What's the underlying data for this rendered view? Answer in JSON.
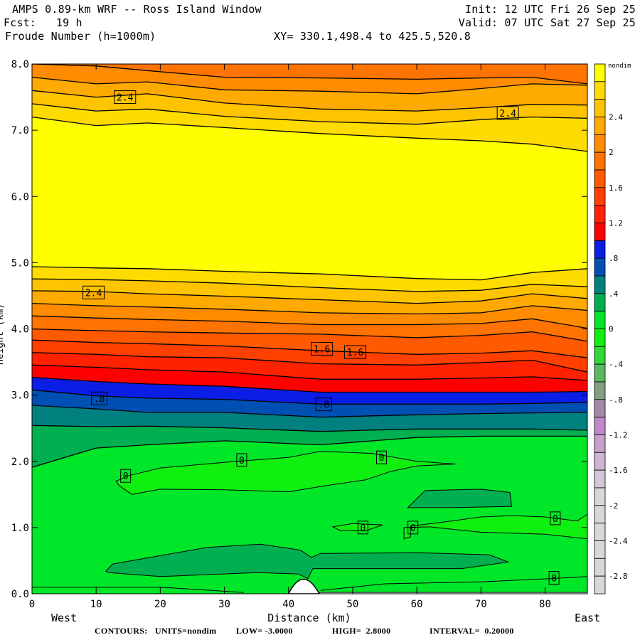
{
  "header": {
    "title": "AMPS 0.89-km WRF -- Ross Island Window",
    "init": "Init: 12 UTC Fri 26 Sep 25",
    "forecast": "Fcst:   19 h",
    "valid": "Valid: 07 UTC Sat 27 Sep 25",
    "field": "Froude Number (h=1000m)",
    "xy": "XY= 330.1,498.4 to 425.5,520.8"
  },
  "footer": {
    "contours": "CONTOURS:",
    "units": "UNITS=nondim",
    "low": "LOW= -3.0000",
    "high": "HIGH=  2.8000",
    "interval": "INTERVAL=  0.20000"
  },
  "chart_data": {
    "type": "heatmap",
    "subtype": "filled-contour cross-section",
    "title": "Froude Number (h=1000m)",
    "xlabel": "Distance (km)",
    "ylabel": "Height (km)",
    "x_left_label": "West",
    "x_right_label": "East",
    "xlim": [
      0,
      86.6
    ],
    "ylim": [
      0,
      8
    ],
    "x_ticks": [
      "0",
      "10",
      "20",
      "30",
      "40",
      "50",
      "60",
      "70",
      "80"
    ],
    "x_tick_values": [
      0,
      10,
      20,
      30,
      40,
      50,
      60,
      70,
      80
    ],
    "y_ticks": [
      "0.0",
      "1.0",
      "2.0",
      "3.0",
      "4.0",
      "5.0",
      "6.0",
      "7.0",
      "8.0"
    ],
    "y_tick_values": [
      0,
      1,
      2,
      3,
      4,
      5,
      6,
      7,
      8
    ],
    "units": "nondim",
    "contour_low": -3.0,
    "contour_high": 2.8,
    "contour_interval": 0.2,
    "colorbar": {
      "unit_label": "nondim",
      "levels_top_to_bottom": [
        3.0,
        2.8,
        2.6,
        2.4,
        2.2,
        2.0,
        1.8,
        1.6,
        1.4,
        1.2,
        1.0,
        0.8,
        0.6,
        0.4,
        0.2,
        0.0,
        -0.2,
        -0.4,
        -0.6,
        -0.8,
        -1.0,
        -1.2,
        -1.4,
        -1.6,
        -1.8,
        -2.0,
        -2.2,
        -2.4,
        -2.6,
        -2.8,
        -3.0
      ],
      "colors_top_to_bottom": [
        "#ffff00",
        "#ffdc00",
        "#ffc400",
        "#ffaa00",
        "#ff8c00",
        "#ff7300",
        "#ff5a00",
        "#ff4000",
        "#ff2200",
        "#ff0000",
        "#0a1ee6",
        "#0050b4",
        "#00807f",
        "#00b050",
        "#00e628",
        "#10f010",
        "#30d838",
        "#5ab860",
        "#80a080",
        "#a888a8",
        "#c088c8",
        "#c8a0cc",
        "#d0b4d4",
        "#d4c8d8",
        "#d8d8d8",
        "#d8d8d8",
        "#d8d8d8",
        "#d8d8d8",
        "#d8d8d8",
        "#d8d8d8"
      ],
      "labels": [
        {
          "text": "2.4",
          "value": 2.4
        },
        {
          "text": "2",
          "value": 2.0
        },
        {
          "text": "1.6",
          "value": 1.6
        },
        {
          "text": "1.2",
          "value": 1.2
        },
        {
          "text": ".8",
          "value": 0.8
        },
        {
          "text": ".4",
          "value": 0.4
        },
        {
          "text": "0",
          "value": 0.0
        },
        {
          "text": "-.4",
          "value": -0.4
        },
        {
          "text": "-.8",
          "value": -0.8
        },
        {
          "text": "-1.2",
          "value": -1.2
        },
        {
          "text": "-1.6",
          "value": -1.6
        },
        {
          "text": "-2",
          "value": -2.0
        },
        {
          "text": "-2.4",
          "value": -2.4
        },
        {
          "text": "-2.8",
          "value": -2.8
        }
      ]
    },
    "top_fill": "#ff7300",
    "x_samples_km": [
      0,
      10,
      18,
      30,
      45,
      60,
      70,
      78,
      86.6
    ],
    "contour_lines": [
      {
        "level": 2.0,
        "fill_below": "#ff8c00",
        "heights": [
          8.0,
          7.97,
          7.9,
          7.8,
          7.79,
          7.77,
          7.79,
          7.8,
          7.7
        ]
      },
      {
        "level": 2.2,
        "fill_below": "#ffaa00",
        "heights": [
          7.8,
          7.7,
          7.73,
          7.61,
          7.59,
          7.55,
          7.63,
          7.7,
          7.68
        ]
      },
      {
        "level": 2.4,
        "fill_below": "#ffc400",
        "heights": [
          7.6,
          7.5,
          7.55,
          7.41,
          7.32,
          7.29,
          7.34,
          7.39,
          7.38
        ]
      },
      {
        "level": 2.6,
        "fill_below": "#ffdc00",
        "heights": [
          7.4,
          7.29,
          7.32,
          7.21,
          7.13,
          7.09,
          7.16,
          7.2,
          7.18
        ]
      },
      {
        "level": 2.8,
        "fill_below": "#ffff00",
        "heights": [
          7.2,
          7.07,
          7.11,
          7.04,
          6.95,
          6.88,
          6.84,
          6.79,
          6.68
        ]
      },
      {
        "level": 2.8,
        "fill_below": "#ffdc00",
        "heights": [
          4.94,
          4.92,
          4.91,
          4.87,
          4.83,
          4.76,
          4.74,
          4.85,
          4.91
        ]
      },
      {
        "level": 2.6,
        "fill_below": "#ffc400",
        "heights": [
          4.755,
          4.744,
          4.726,
          4.69,
          4.623,
          4.565,
          4.583,
          4.673,
          4.637
        ]
      },
      {
        "level": 2.4,
        "fill_below": "#ffaa00",
        "heights": [
          4.576,
          4.565,
          4.53,
          4.494,
          4.44,
          4.386,
          4.422,
          4.53,
          4.458
        ]
      },
      {
        "level": 2.2,
        "fill_below": "#ff8c00",
        "heights": [
          4.386,
          4.35,
          4.332,
          4.297,
          4.243,
          4.225,
          4.243,
          4.35,
          4.279
        ]
      },
      {
        "level": 2.0,
        "fill_below": "#ff7300",
        "heights": [
          4.196,
          4.164,
          4.143,
          4.117,
          4.064,
          4.064,
          4.082,
          4.153,
          4.01
        ]
      },
      {
        "level": 1.8,
        "fill_below": "#ff5a00",
        "heights": [
          3.999,
          3.974,
          3.956,
          3.938,
          3.92,
          3.867,
          3.902,
          3.956,
          3.813
        ]
      },
      {
        "level": 1.6,
        "fill_below": "#ff4000",
        "heights": [
          3.831,
          3.795,
          3.777,
          3.742,
          3.67,
          3.616,
          3.634,
          3.67,
          3.563
        ]
      },
      {
        "level": 1.4,
        "fill_below": "#ff2200",
        "heights": [
          3.642,
          3.616,
          3.58,
          3.563,
          3.473,
          3.455,
          3.491,
          3.527,
          3.348
        ]
      },
      {
        "level": 1.2,
        "fill_below": "#ff0000",
        "heights": [
          3.455,
          3.42,
          3.384,
          3.348,
          3.24,
          3.24,
          3.258,
          3.276,
          3.222
        ]
      },
      {
        "level": 1.0,
        "fill_below": "#0a1ee6",
        "heights": [
          3.269,
          3.205,
          3.169,
          3.133,
          3.044,
          3.044,
          3.044,
          3.044,
          3.054
        ]
      },
      {
        "level": 0.8,
        "fill_below": "#0050b4",
        "heights": [
          3.079,
          2.99,
          2.954,
          2.936,
          2.864,
          2.864,
          2.864,
          2.875,
          2.889
        ]
      },
      {
        "level": 0.6,
        "fill_below": "#00807f",
        "heights": [
          2.846,
          2.792,
          2.739,
          2.739,
          2.667,
          2.703,
          2.721,
          2.732,
          2.739
        ]
      },
      {
        "level": 0.4,
        "fill_below": "#00b050",
        "heights": [
          2.542,
          2.524,
          2.531,
          2.506,
          2.452,
          2.488,
          2.488,
          2.488,
          2.47
        ]
      },
      {
        "level": 0.2,
        "fill_below": "#00e628",
        "heights": [
          1.91,
          2.2,
          2.25,
          2.31,
          2.25,
          2.36,
          2.38,
          2.38,
          2.38
        ]
      }
    ],
    "regions": [
      {
        "name": "below-zero-lens-upper",
        "fill": "#10f010",
        "points": [
          [
            13.1,
            1.7
          ],
          [
            15,
            1.78
          ],
          [
            20,
            1.9
          ],
          [
            30.6,
            1.99
          ],
          [
            40,
            2.06
          ],
          [
            45,
            2.15
          ],
          [
            53,
            2.12
          ],
          [
            60,
            2.0
          ],
          [
            66,
            1.96
          ],
          [
            60,
            1.93
          ],
          [
            56,
            1.85
          ],
          [
            52,
            1.72
          ],
          [
            45,
            1.62
          ],
          [
            40,
            1.54
          ],
          [
            30,
            1.57
          ],
          [
            20,
            1.58
          ],
          [
            15.6,
            1.5
          ],
          [
            13.6,
            1.63
          ]
        ]
      },
      {
        "name": "dark-patch-mid",
        "fill": "#00b050",
        "points": [
          [
            58.6,
            1.3
          ],
          [
            61.3,
            1.56
          ],
          [
            70,
            1.58
          ],
          [
            74.5,
            1.53
          ],
          [
            74.8,
            1.32
          ],
          [
            65,
            1.3
          ]
        ]
      },
      {
        "name": "below-zero-lens-small",
        "fill": "#10f010",
        "points": [
          [
            46.9,
            1.01
          ],
          [
            50,
            1.06
          ],
          [
            54.7,
            1.04
          ],
          [
            52,
            0.95
          ],
          [
            48,
            0.96
          ]
        ]
      },
      {
        "name": "below-zero-lens-right",
        "fill": "#10f010",
        "points": [
          [
            58,
            1.0
          ],
          [
            58,
            0.83
          ],
          [
            59,
            0.86
          ],
          [
            59,
            1.02
          ],
          [
            64,
            1.08
          ],
          [
            70,
            1.16
          ],
          [
            75,
            1.18
          ],
          [
            80,
            1.16
          ],
          [
            85,
            1.1
          ],
          [
            86.6,
            1.2
          ],
          [
            86.6,
            0.83
          ],
          [
            80,
            0.9
          ],
          [
            70,
            0.93
          ],
          [
            65,
            0.98
          ],
          [
            62,
            1.01
          ]
        ]
      },
      {
        "name": "dark-patch-low",
        "fill": "#00b050",
        "points": [
          [
            11.5,
            0.34
          ],
          [
            12.6,
            0.45
          ],
          [
            27.3,
            0.7
          ],
          [
            35.6,
            0.75
          ],
          [
            41.8,
            0.66
          ],
          [
            43.6,
            0.55
          ],
          [
            45,
            0.61
          ],
          [
            60,
            0.62
          ],
          [
            71.3,
            0.59
          ],
          [
            74.3,
            0.48
          ],
          [
            67,
            0.38
          ],
          [
            55,
            0.38
          ],
          [
            43.8,
            0.38
          ],
          [
            43,
            0.23
          ],
          [
            41.5,
            0.3
          ],
          [
            35,
            0.32
          ],
          [
            20,
            0.26
          ],
          [
            12,
            0.32
          ]
        ]
      }
    ],
    "contour_labels": [
      {
        "text": "2.4",
        "x": 14.5,
        "y": 7.5
      },
      {
        "text": "2.4",
        "x": 74.2,
        "y": 7.26
      },
      {
        "text": "2.4",
        "x": 9.6,
        "y": 4.55
      },
      {
        "text": "1.6",
        "x": 45.2,
        "y": 3.7
      },
      {
        "text": "1.6",
        "x": 50.4,
        "y": 3.65
      },
      {
        "text": ".8",
        "x": 10.5,
        "y": 2.95
      },
      {
        "text": ".8",
        "x": 45.5,
        "y": 2.86
      },
      {
        "text": "0",
        "x": 14.6,
        "y": 1.78
      },
      {
        "text": "0",
        "x": 32.7,
        "y": 2.02
      },
      {
        "text": "0",
        "x": 54.5,
        "y": 2.06
      },
      {
        "text": "0",
        "x": 51.6,
        "y": 1.0
      },
      {
        "text": "0",
        "x": 59.4,
        "y": 1.0
      },
      {
        "text": "0",
        "x": 81.6,
        "y": 1.14
      },
      {
        "text": "0",
        "x": 81.4,
        "y": 0.24
      }
    ],
    "terrain": {
      "peak_x": 42.3,
      "peak_h": 0.22,
      "base_left": 40.0,
      "base_right": 44.8,
      "surface_h_east": 0.02
    }
  }
}
